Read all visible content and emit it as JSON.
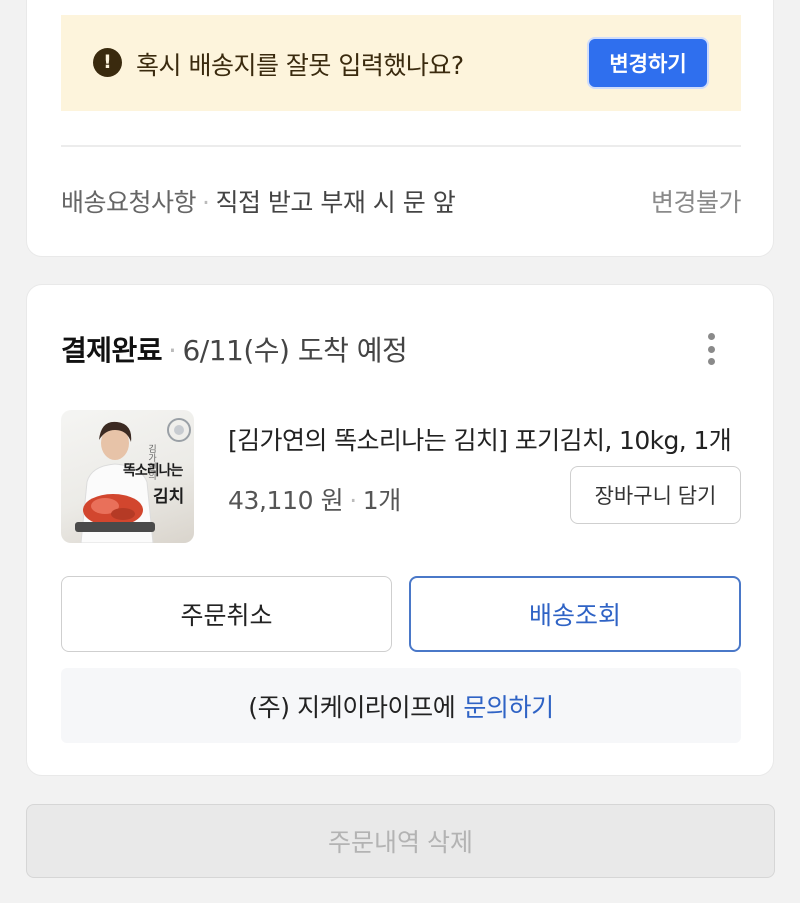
{
  "notice": {
    "icon": "exclamation-circle-icon",
    "message": "혹시 배송지를 잘못 입력했나요?",
    "change_label": "변경하기",
    "accent": "#2f6fee"
  },
  "delivery_request": {
    "label": "배송요청사항",
    "value": "직접 받고 부재 시 문 앞",
    "status": "변경불가"
  },
  "order": {
    "status": "결제완료",
    "arrival": "6/11(수) 도착 예정",
    "menu_icon": "more-vertical-icon",
    "product": {
      "name": "[김가연의 똑소리나는 김치] 포기김치, 10kg, 1개",
      "price": "43,110 원",
      "quantity": "1개",
      "thumbnail_text": "똑소리나는",
      "thumbnail_text2": "김치",
      "thumbnail_small": "김가연의"
    },
    "cart_button": "장바구니 담기",
    "cancel_button": "주문취소",
    "track_button": "배송조회",
    "seller": "(주) 지케이라이프에",
    "inquiry_link": "문의하기"
  },
  "delete_button": "주문내역 삭제",
  "colors": {
    "background": "#f2f2f2",
    "notice_bg": "#fdf4dc",
    "link": "#2f63c5"
  }
}
